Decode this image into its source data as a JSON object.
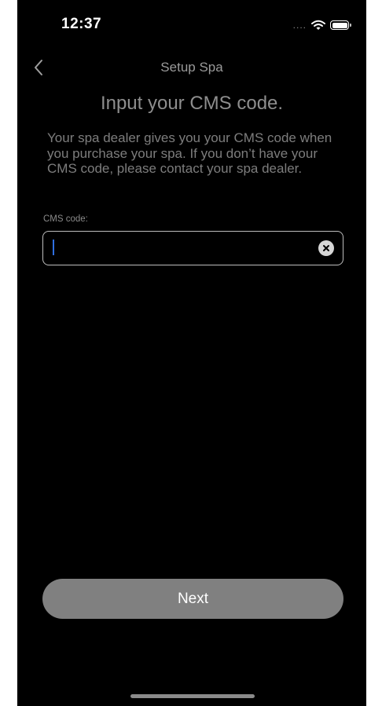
{
  "status_bar": {
    "time": "12:37",
    "signal": "....",
    "icons": [
      "wifi-icon",
      "battery-icon"
    ]
  },
  "nav": {
    "back_icon": "chevron-left-icon",
    "title": "Setup Spa"
  },
  "content": {
    "heading": "Input your CMS code.",
    "description": "Your spa dealer gives you your CMS code when you purchase your spa. If you don’t have your CMS code, please contact your spa dealer.",
    "field_label": "CMS code:",
    "input_value": "",
    "input_placeholder": "",
    "clear_icon": "clear-x-icon"
  },
  "actions": {
    "next_label": "Next"
  },
  "colors": {
    "background": "#000000",
    "button": "#808080",
    "caret": "#2f6fe0"
  }
}
